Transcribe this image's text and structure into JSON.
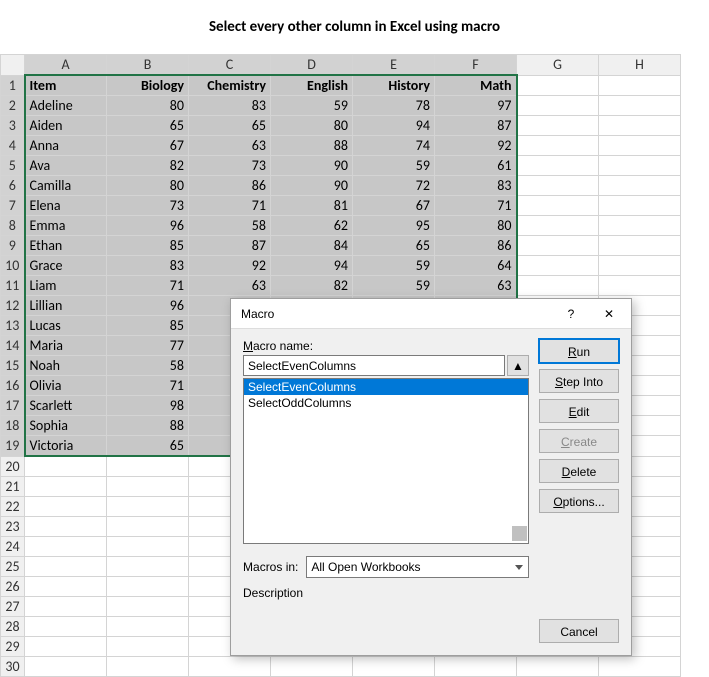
{
  "title": "Select every other column in Excel using macro",
  "columns": [
    "A",
    "B",
    "C",
    "D",
    "E",
    "F",
    "G",
    "H"
  ],
  "selectedColIdx": [
    0,
    1,
    2,
    3,
    4,
    5
  ],
  "rowCount": 30,
  "dataRowCount": 19,
  "headers": [
    "Item",
    "Biology",
    "Chemistry",
    "English",
    "History",
    "Math"
  ],
  "rows": [
    [
      "Adeline",
      80,
      83,
      59,
      78,
      97
    ],
    [
      "Aiden",
      65,
      65,
      80,
      94,
      87
    ],
    [
      "Anna",
      67,
      63,
      88,
      74,
      92
    ],
    [
      "Ava",
      82,
      73,
      90,
      59,
      61
    ],
    [
      "Camilla",
      80,
      86,
      90,
      72,
      83
    ],
    [
      "Elena",
      73,
      71,
      81,
      67,
      71
    ],
    [
      "Emma",
      96,
      58,
      62,
      95,
      80
    ],
    [
      "Ethan",
      85,
      87,
      84,
      65,
      86
    ],
    [
      "Grace",
      83,
      92,
      94,
      59,
      64
    ],
    [
      "Liam",
      71,
      63,
      82,
      59,
      63
    ],
    [
      "Lillian",
      96,
      null,
      null,
      null,
      null
    ],
    [
      "Lucas",
      85,
      null,
      null,
      null,
      null
    ],
    [
      "Maria",
      77,
      null,
      null,
      null,
      null
    ],
    [
      "Noah",
      58,
      null,
      null,
      null,
      null
    ],
    [
      "Olivia",
      71,
      null,
      null,
      null,
      null
    ],
    [
      "Scarlett",
      98,
      null,
      null,
      null,
      null
    ],
    [
      "Sophia",
      88,
      null,
      null,
      null,
      null
    ],
    [
      "Victoria",
      65,
      null,
      null,
      null,
      null
    ]
  ],
  "dialog": {
    "title": "Macro",
    "help_icon": "?",
    "close_icon": "✕",
    "macro_name_label_pre": "M",
    "macro_name_label_post": "acro name:",
    "macro_name_value": "SelectEvenColumns",
    "macro_list": [
      "SelectEvenColumns",
      "SelectOddColumns"
    ],
    "selected_macro_index": 0,
    "buttons": {
      "run_u": "R",
      "run_post": "un",
      "stepinto_pre": "S",
      "stepinto_post": "tep Into",
      "edit_u": "E",
      "edit_post": "dit",
      "create_u": "C",
      "create_post": "reate",
      "delete_u": "D",
      "delete_post": "elete",
      "options_u": "O",
      "options_post": "ptions...",
      "cancel": "Cancel"
    },
    "macros_in_label_pre": "M",
    "macros_in_label_u": "a",
    "macros_in_label_post": "cros in:",
    "macros_in_value": "All Open Workbooks",
    "description_label": "Description"
  }
}
